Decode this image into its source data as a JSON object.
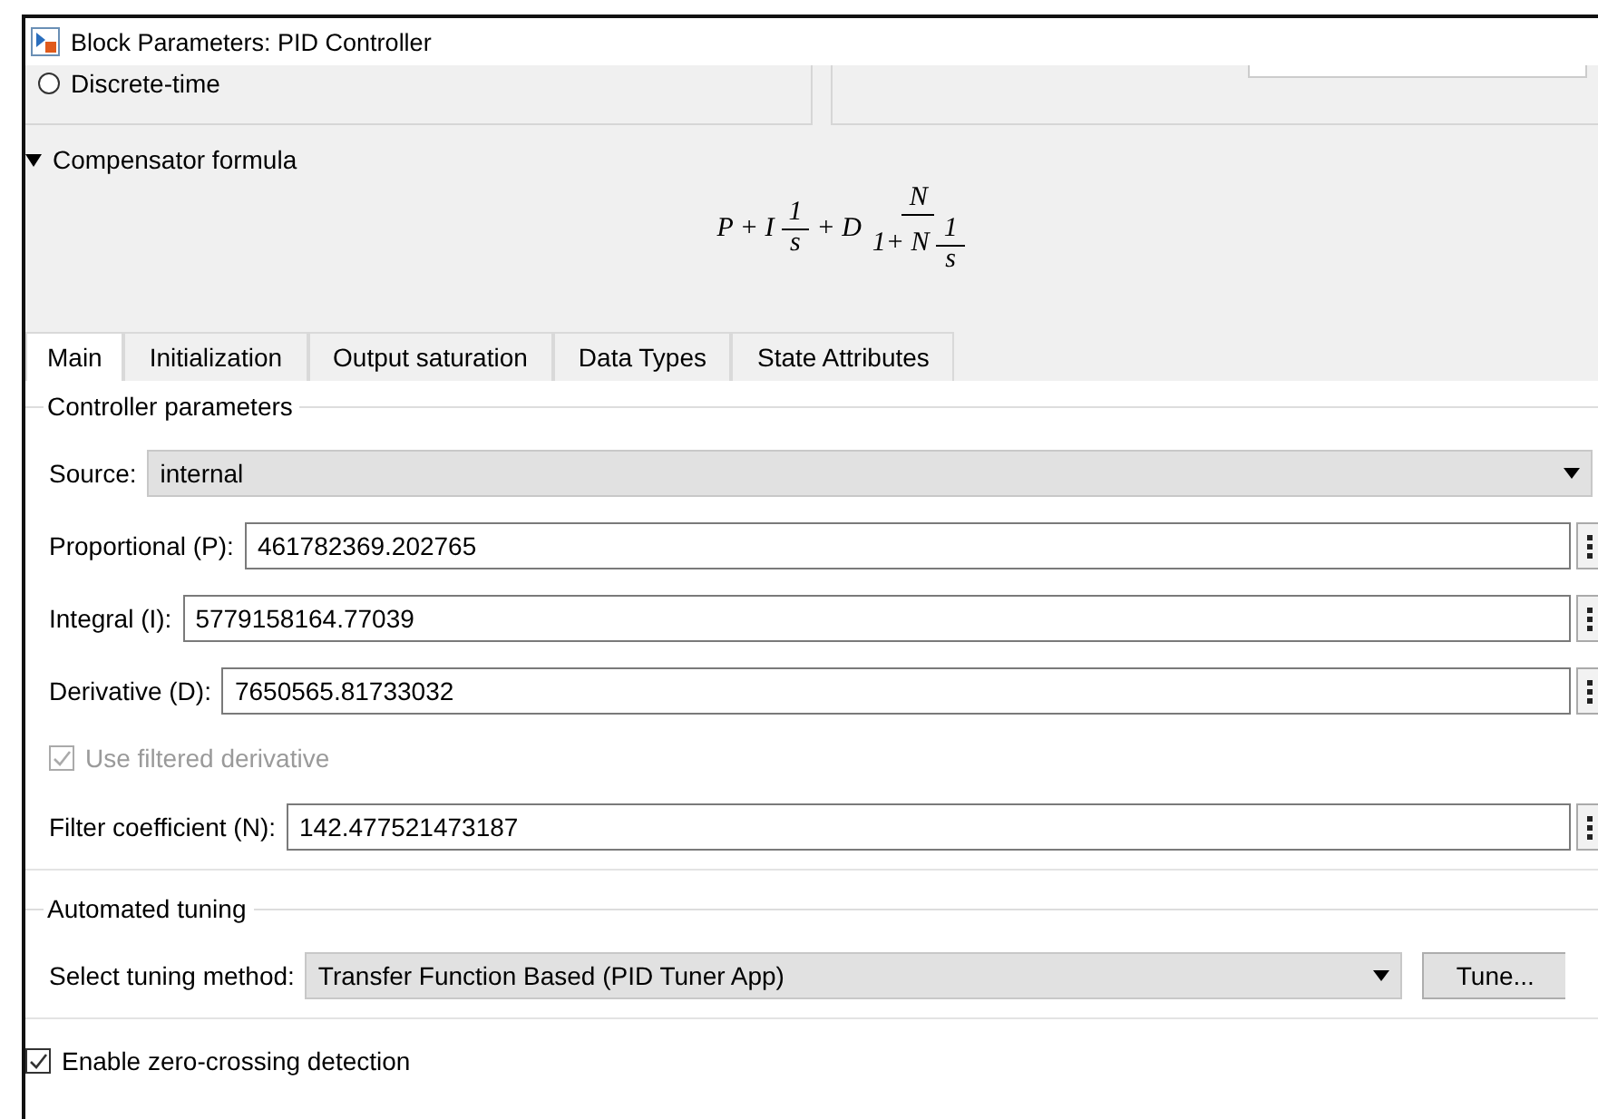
{
  "window": {
    "title": "Block Parameters: PID Controller"
  },
  "time_domain": {
    "label": "Discrete-time",
    "selected": false
  },
  "formula_section": {
    "label": "Compensator formula",
    "expanded": true,
    "formula": [
      {
        "kind": "text",
        "text": "P + I"
      },
      {
        "kind": "frac",
        "num": [
          {
            "kind": "text",
            "text": "1"
          }
        ],
        "den": [
          {
            "kind": "text",
            "text": "s"
          }
        ]
      },
      {
        "kind": "text",
        "text": "+ D"
      },
      {
        "kind": "frac",
        "num": [
          {
            "kind": "text",
            "text": "N"
          }
        ],
        "den": [
          {
            "kind": "text",
            "text": "1+ N"
          },
          {
            "kind": "frac",
            "num": [
              {
                "kind": "text",
                "text": "1"
              }
            ],
            "den": [
              {
                "kind": "text",
                "text": "s"
              }
            ]
          }
        ]
      }
    ]
  },
  "tabs": [
    {
      "label": "Main",
      "selected": true
    },
    {
      "label": "Initialization",
      "selected": false
    },
    {
      "label": "Output saturation",
      "selected": false
    },
    {
      "label": "Data Types",
      "selected": false
    },
    {
      "label": "State Attributes",
      "selected": false
    }
  ],
  "controller_parameters": {
    "title": "Controller parameters",
    "source": {
      "label": "Source:",
      "value": "internal"
    },
    "rows": [
      {
        "kind": "field",
        "label": "Proportional (P):",
        "value": "461782369.202765"
      },
      {
        "kind": "field",
        "label": "Integral (I):",
        "value": "5779158164.77039"
      },
      {
        "kind": "field",
        "label": "Derivative (D):",
        "value": "7650565.81733032"
      },
      {
        "kind": "checkbox",
        "label": "Use filtered derivative",
        "checked": true,
        "disabled": true
      },
      {
        "kind": "field",
        "label": "Filter coefficient (N):",
        "value": "142.477521473187"
      }
    ]
  },
  "automated_tuning": {
    "title": "Automated tuning",
    "method_label": "Select tuning method:",
    "method": "Transfer Function Based (PID Tuner App)",
    "button": "Tune..."
  },
  "zero_crossing": {
    "label": "Enable zero-crossing detection",
    "checked": true,
    "disabled": false
  }
}
